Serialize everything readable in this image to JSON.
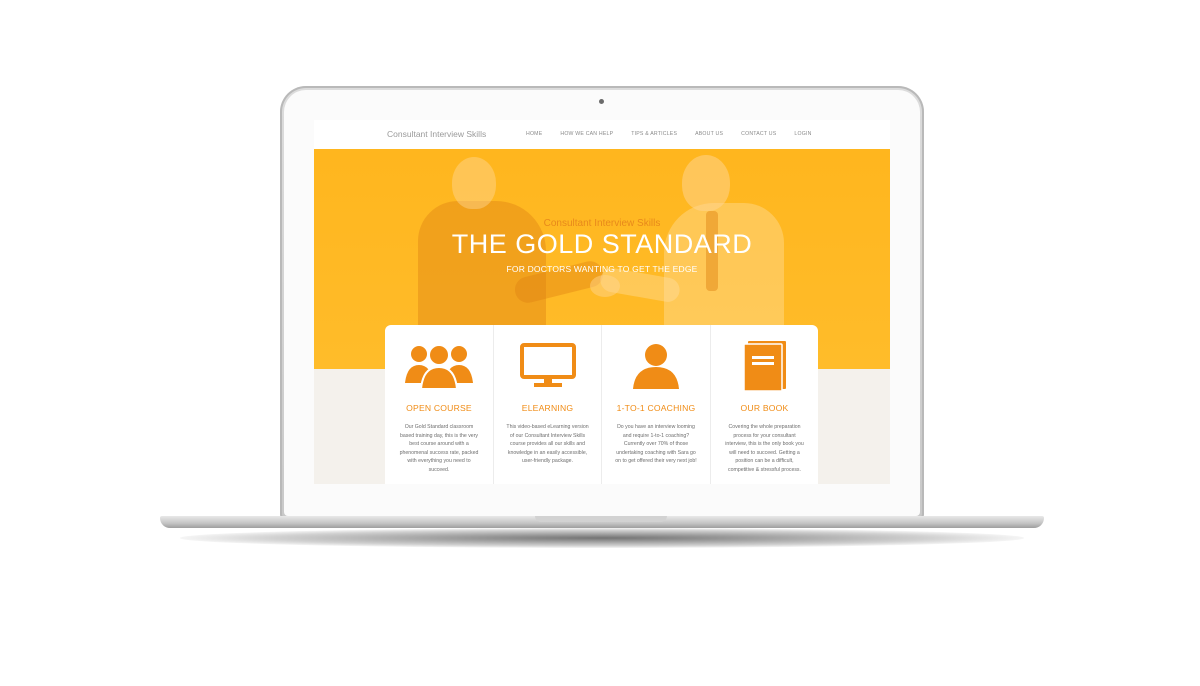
{
  "site": {
    "brand": "Consultant Interview Skills",
    "accent_color": "#ffb61e",
    "icon_color": "#f08c16"
  },
  "nav": {
    "items": [
      "HOME",
      "HOW WE CAN HELP",
      "TIPS & ARTICLES",
      "ABOUT US",
      "CONTACT US",
      "LOGIN"
    ]
  },
  "hero": {
    "subtitle": "Consultant Interview Skills",
    "title": "THE GOLD STANDARD",
    "tagline": "FOR DOCTORS WANTING TO GET THE EDGE"
  },
  "features": [
    {
      "icon": "group-icon",
      "title": "OPEN COURSE",
      "text": "Our Gold Standard classroom based training day, this is the very best course around with a phenomenal success rate, packed with everything you need to succeed."
    },
    {
      "icon": "monitor-icon",
      "title": "ELEARNING",
      "text": "This video-based eLearning version of our Consultant Interview Skills course provides all our skills and knowledge in an easily accessible, user-friendly package."
    },
    {
      "icon": "person-icon",
      "title": "1-TO-1 COACHING",
      "text": "Do you have an interview looming and require 1-to-1 coaching? Currently over 70% of those undertaking coaching with Sara go on to get offered their very next job!"
    },
    {
      "icon": "book-icon",
      "title": "OUR BOOK",
      "text": "Covering the whole preparation process for your consultant interview, this is the only book you will need to succeed. Getting a position can be a difficult, competitive & stressful process."
    }
  ]
}
